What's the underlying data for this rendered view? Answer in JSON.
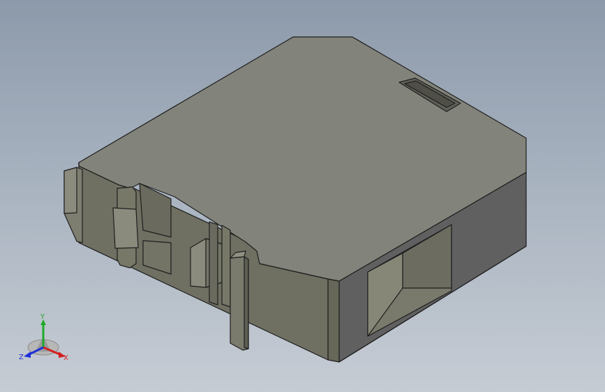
{
  "viewport": {
    "background_top": "#8d9aab",
    "background_bottom": "#c6ccd4"
  },
  "model": {
    "top_face_color": "#82837a",
    "front_face_color": "#6f7062",
    "right_face_color": "#606060",
    "edge_color": "#1e1e1e"
  },
  "triad": {
    "x_label": "X",
    "y_label": "Y",
    "z_label": "Z",
    "x_color": "#d32020",
    "y_color": "#1faa2a",
    "z_color": "#2030d8"
  }
}
